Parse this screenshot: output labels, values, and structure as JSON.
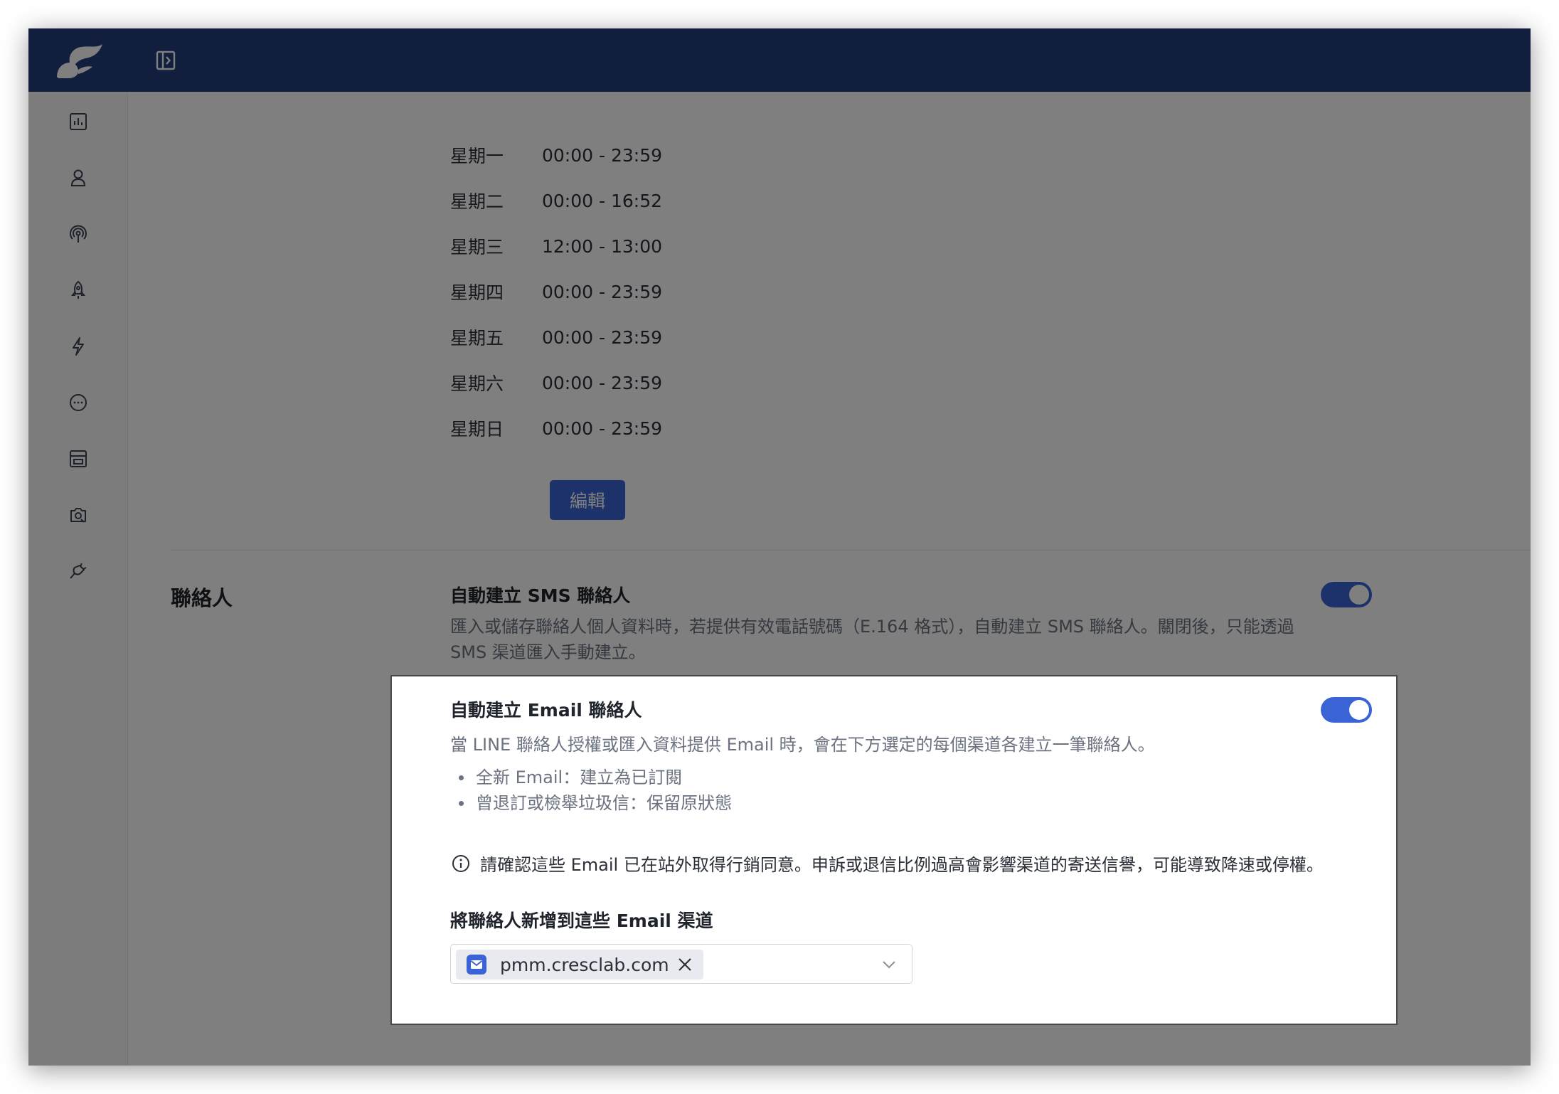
{
  "colors": {
    "topbar": "#243d7a",
    "primary": "#3a63d6",
    "text": "#1f232b",
    "muted": "#6b7280"
  },
  "topbar": {
    "logo": "cresclab-bird-logo",
    "collapse_icon": "sidebar-collapse-icon"
  },
  "sidebar": {
    "items": [
      {
        "icon": "insights-chart-icon"
      },
      {
        "icon": "user-icon"
      },
      {
        "icon": "broadcast-icon"
      },
      {
        "icon": "rocket-icon"
      },
      {
        "icon": "lightning-icon"
      },
      {
        "icon": "chat-icon"
      },
      {
        "icon": "store-icon"
      },
      {
        "icon": "camera-icon"
      },
      {
        "icon": "plug-icon"
      }
    ]
  },
  "business_hours": [
    {
      "day": "星期一",
      "time": "00:00 - 23:59"
    },
    {
      "day": "星期二",
      "time": "00:00 - 16:52"
    },
    {
      "day": "星期三",
      "time": "12:00 - 13:00"
    },
    {
      "day": "星期四",
      "time": "00:00 - 23:59"
    },
    {
      "day": "星期五",
      "time": "00:00 - 23:59"
    },
    {
      "day": "星期六",
      "time": "00:00 - 23:59"
    },
    {
      "day": "星期日",
      "time": "00:00 - 23:59"
    }
  ],
  "edit_button": "編輯",
  "contacts": {
    "section_title": "聯絡人",
    "sms": {
      "title": "自動建立 SMS 聯絡人",
      "description": "匯入或儲存聯絡人個人資料時，若提供有效電話號碼（E.164 格式），自動建立 SMS 聯絡人。關閉後，只能透過 SMS 渠道匯入手動建立。",
      "enabled": true
    },
    "email": {
      "title": "自動建立 Email 聯絡人",
      "description": "當 LINE 聯絡人授權或匯入資料提供 Email 時，會在下方選定的每個渠道各建立一筆聯絡人。",
      "bullets": [
        "全新 Email：建立為已訂閱",
        "曾退訂或檢舉垃圾信：保留原狀態"
      ],
      "notice": "請確認這些 Email 已在站外取得行銷同意。申訴或退信比例過高會影響渠道的寄送信譽，可能導致降速或停權。",
      "channel_label": "將聯絡人新增到這些 Email 渠道",
      "selected_channel": "pmm.cresclab.com",
      "enabled": true
    }
  }
}
